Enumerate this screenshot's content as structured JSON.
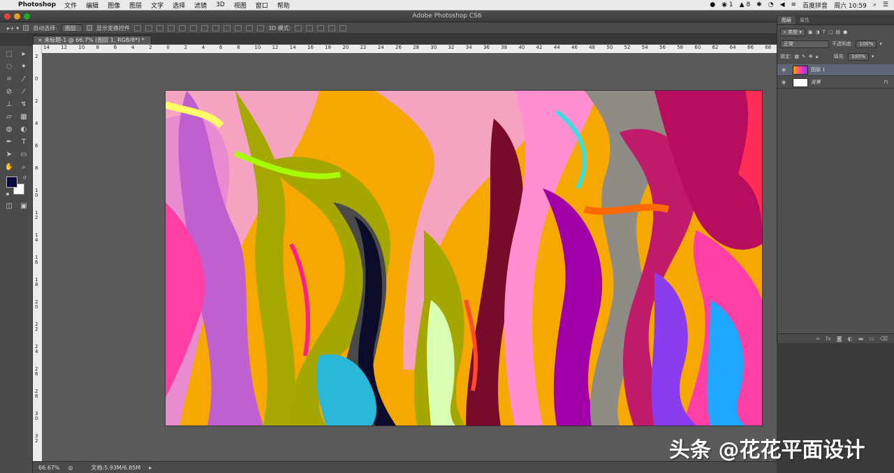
{
  "menubar": {
    "app_name": "Photoshop",
    "menus": [
      "文件",
      "编辑",
      "图像",
      "图层",
      "文字",
      "选择",
      "滤镜",
      "3D",
      "视图",
      "窗口",
      "帮助"
    ],
    "status_items": [
      "1",
      "8",
      "百度拼音",
      "周六 10:59"
    ]
  },
  "window": {
    "title": "Adobe Photoshop CS6"
  },
  "options_bar": {
    "auto_select_label": "自动选择:",
    "auto_select_value": "图层",
    "show_transform_label": "显示变换控件",
    "mode_3d_label": "3D 模式:"
  },
  "document_tab": {
    "title": "未标题-1 @ 66.7% (图层 1, RGB/8*) *"
  },
  "rulers": {
    "h_ticks": [
      "14",
      "12",
      "10",
      "8",
      "6",
      "4",
      "2",
      "0",
      "2",
      "4",
      "6",
      "8",
      "10",
      "12",
      "14",
      "16",
      "18",
      "20",
      "22",
      "24",
      "26",
      "28",
      "30",
      "32",
      "34",
      "36",
      "38",
      "40",
      "42",
      "44",
      "46",
      "48",
      "50",
      "52",
      "54",
      "56",
      "58",
      "60",
      "62",
      "64",
      "66",
      "68"
    ],
    "v_ticks": [
      "2",
      "0",
      "2",
      "4",
      "6",
      "8",
      "1\n0",
      "1\n2",
      "1\n4",
      "1\n6",
      "1\n8",
      "2\n0",
      "2\n2",
      "2\n4",
      "2\n6",
      "2\n8",
      "3\n0",
      "3\n2"
    ]
  },
  "status_bar": {
    "zoom": "66.67%",
    "doc_info": "文档:5.93M/6.85M"
  },
  "layers_panel": {
    "tabs": [
      "图层",
      "属性"
    ],
    "filter_label": "类型",
    "blend_mode": "正常",
    "opacity_label": "不透明度:",
    "opacity_value": "100%",
    "lock_label": "锁定:",
    "fill_label": "填充:",
    "fill_value": "100%",
    "layers": [
      {
        "name": "图层 1",
        "selected": true
      },
      {
        "name": "背景",
        "selected": false,
        "locked": true
      }
    ]
  },
  "watermark": "头条 @花花平面设计"
}
